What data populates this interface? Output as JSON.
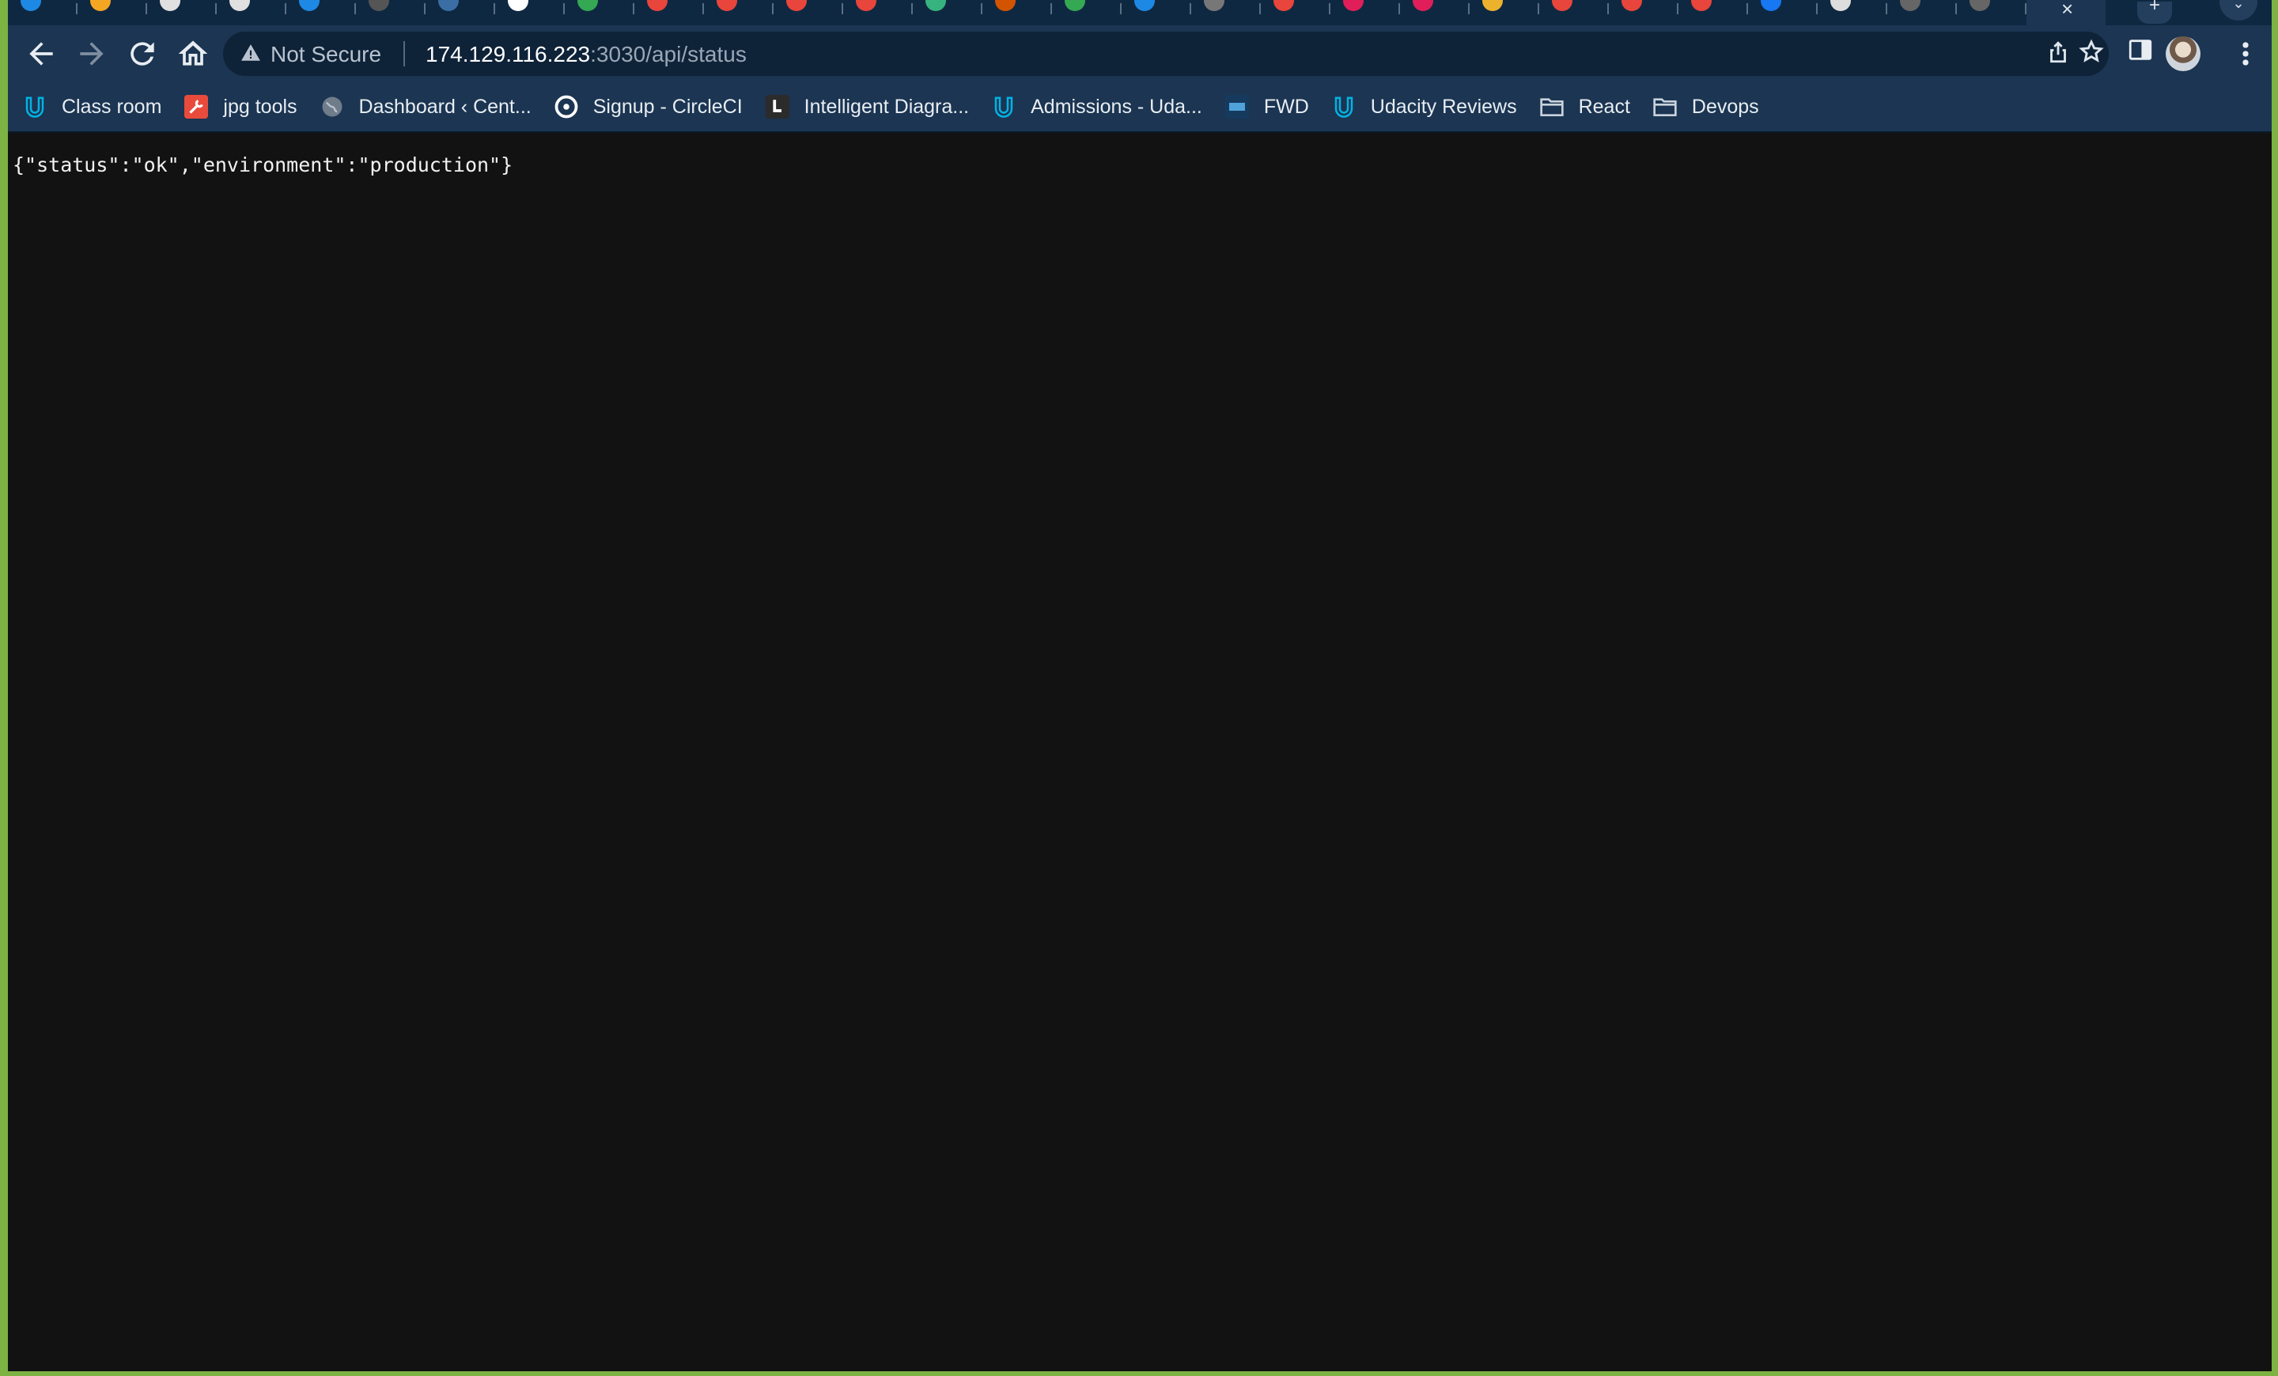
{
  "browser": {
    "address_bar": {
      "security_label": "Not Secure",
      "url_host": "174.129.116.223",
      "url_path": ":3030/api/status"
    },
    "tab_icon_colors": [
      "#1e88e5",
      "#f4a623",
      "#e0e0e0",
      "#e0e0e0",
      "#1e88e5",
      "#222222",
      "#3a6ea5",
      "#ffffff",
      "#34a853",
      "#e8453c",
      "#e8453c",
      "#e8453c",
      "#e8453c",
      "#36b37e",
      "#d35400",
      "#34a853",
      "#1e88e5",
      "#777777",
      "#e8453c",
      "#e01e5a",
      "#e01e5a",
      "#ecb22e",
      "#e8453c",
      "#e8453c",
      "#e8453c",
      "#1877f2",
      "#dddddd",
      "#666666",
      "#666666"
    ],
    "bookmarks": [
      {
        "label": "Class room",
        "icon": "udacity-icon",
        "color": "#02b3e4"
      },
      {
        "label": "jpg tools",
        "icon": "wrench-icon",
        "color": "#e84b3c"
      },
      {
        "label": "Dashboard ‹ Cent...",
        "icon": "globe-icon",
        "color": "#9aa5b1"
      },
      {
        "label": "Signup - CircleCI",
        "icon": "circleci-icon",
        "color": "#ffffff"
      },
      {
        "label": "Intelligent Diagra...",
        "icon": "lucid-icon",
        "color": "#2b2b2b"
      },
      {
        "label": "Admissions - Uda...",
        "icon": "udacity-icon",
        "color": "#02b3e4"
      },
      {
        "label": "FWD",
        "icon": "fwd-icon",
        "color": "#153a5e"
      },
      {
        "label": "Udacity Reviews",
        "icon": "udacity-icon",
        "color": "#02b3e4"
      },
      {
        "label": "React",
        "icon": "folder-icon",
        "color": "#c9d2dc"
      },
      {
        "label": "Devops",
        "icon": "folder-icon",
        "color": "#c9d2dc"
      }
    ]
  },
  "page": {
    "json_text": "{\"status\":\"ok\",\"environment\":\"production\"}"
  }
}
